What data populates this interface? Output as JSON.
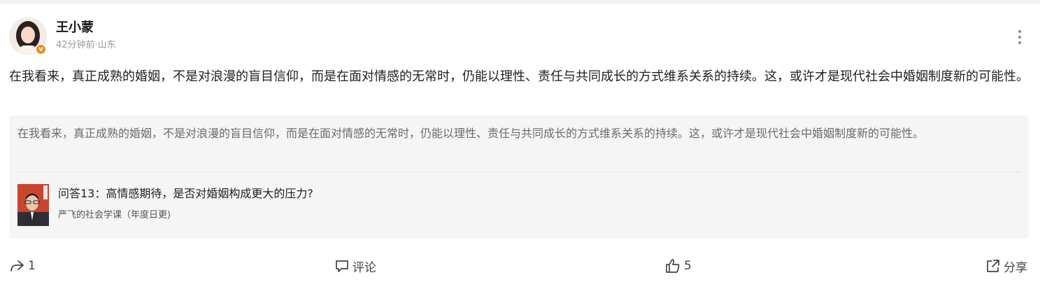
{
  "post": {
    "author": {
      "name": "王小蒙",
      "meta": "42分钟前·山东",
      "verified_badge": "v"
    },
    "body": "在我看来，真正成熟的婚姻，不是对浪漫的盲目信仰，而是在面对情感的无常时，仍能以理性、责任与共同成长的方式维系关系的持续。这，或许才是现代社会中婚姻制度新的可能性。",
    "quote": {
      "text": "在我看来，真正成熟的婚姻，不是对浪漫的盲目信仰，而是在面对情感的无常时，仍能以理性、责任与共同成长的方式维系关系的持续。这，或许才是现代社会中婚姻制度新的可能性。",
      "card_title": "问答13：高情感期待，是否对婚姻构成更大的压力?",
      "card_source": "严飞的社会学课（年度日更)"
    },
    "actions": {
      "repost_count": "1",
      "comment_label": "评论",
      "like_count": "5",
      "share_label": "分享"
    }
  },
  "colors": {
    "badge": "#f28a1f",
    "quote_bg": "#f5f5f5",
    "thumb_bg": "#c8462f"
  },
  "icons": [
    "more-vertical-icon",
    "repost-arrow-icon",
    "comment-icon",
    "thumbs-up-icon",
    "share-external-icon",
    "verified-badge-icon"
  ]
}
